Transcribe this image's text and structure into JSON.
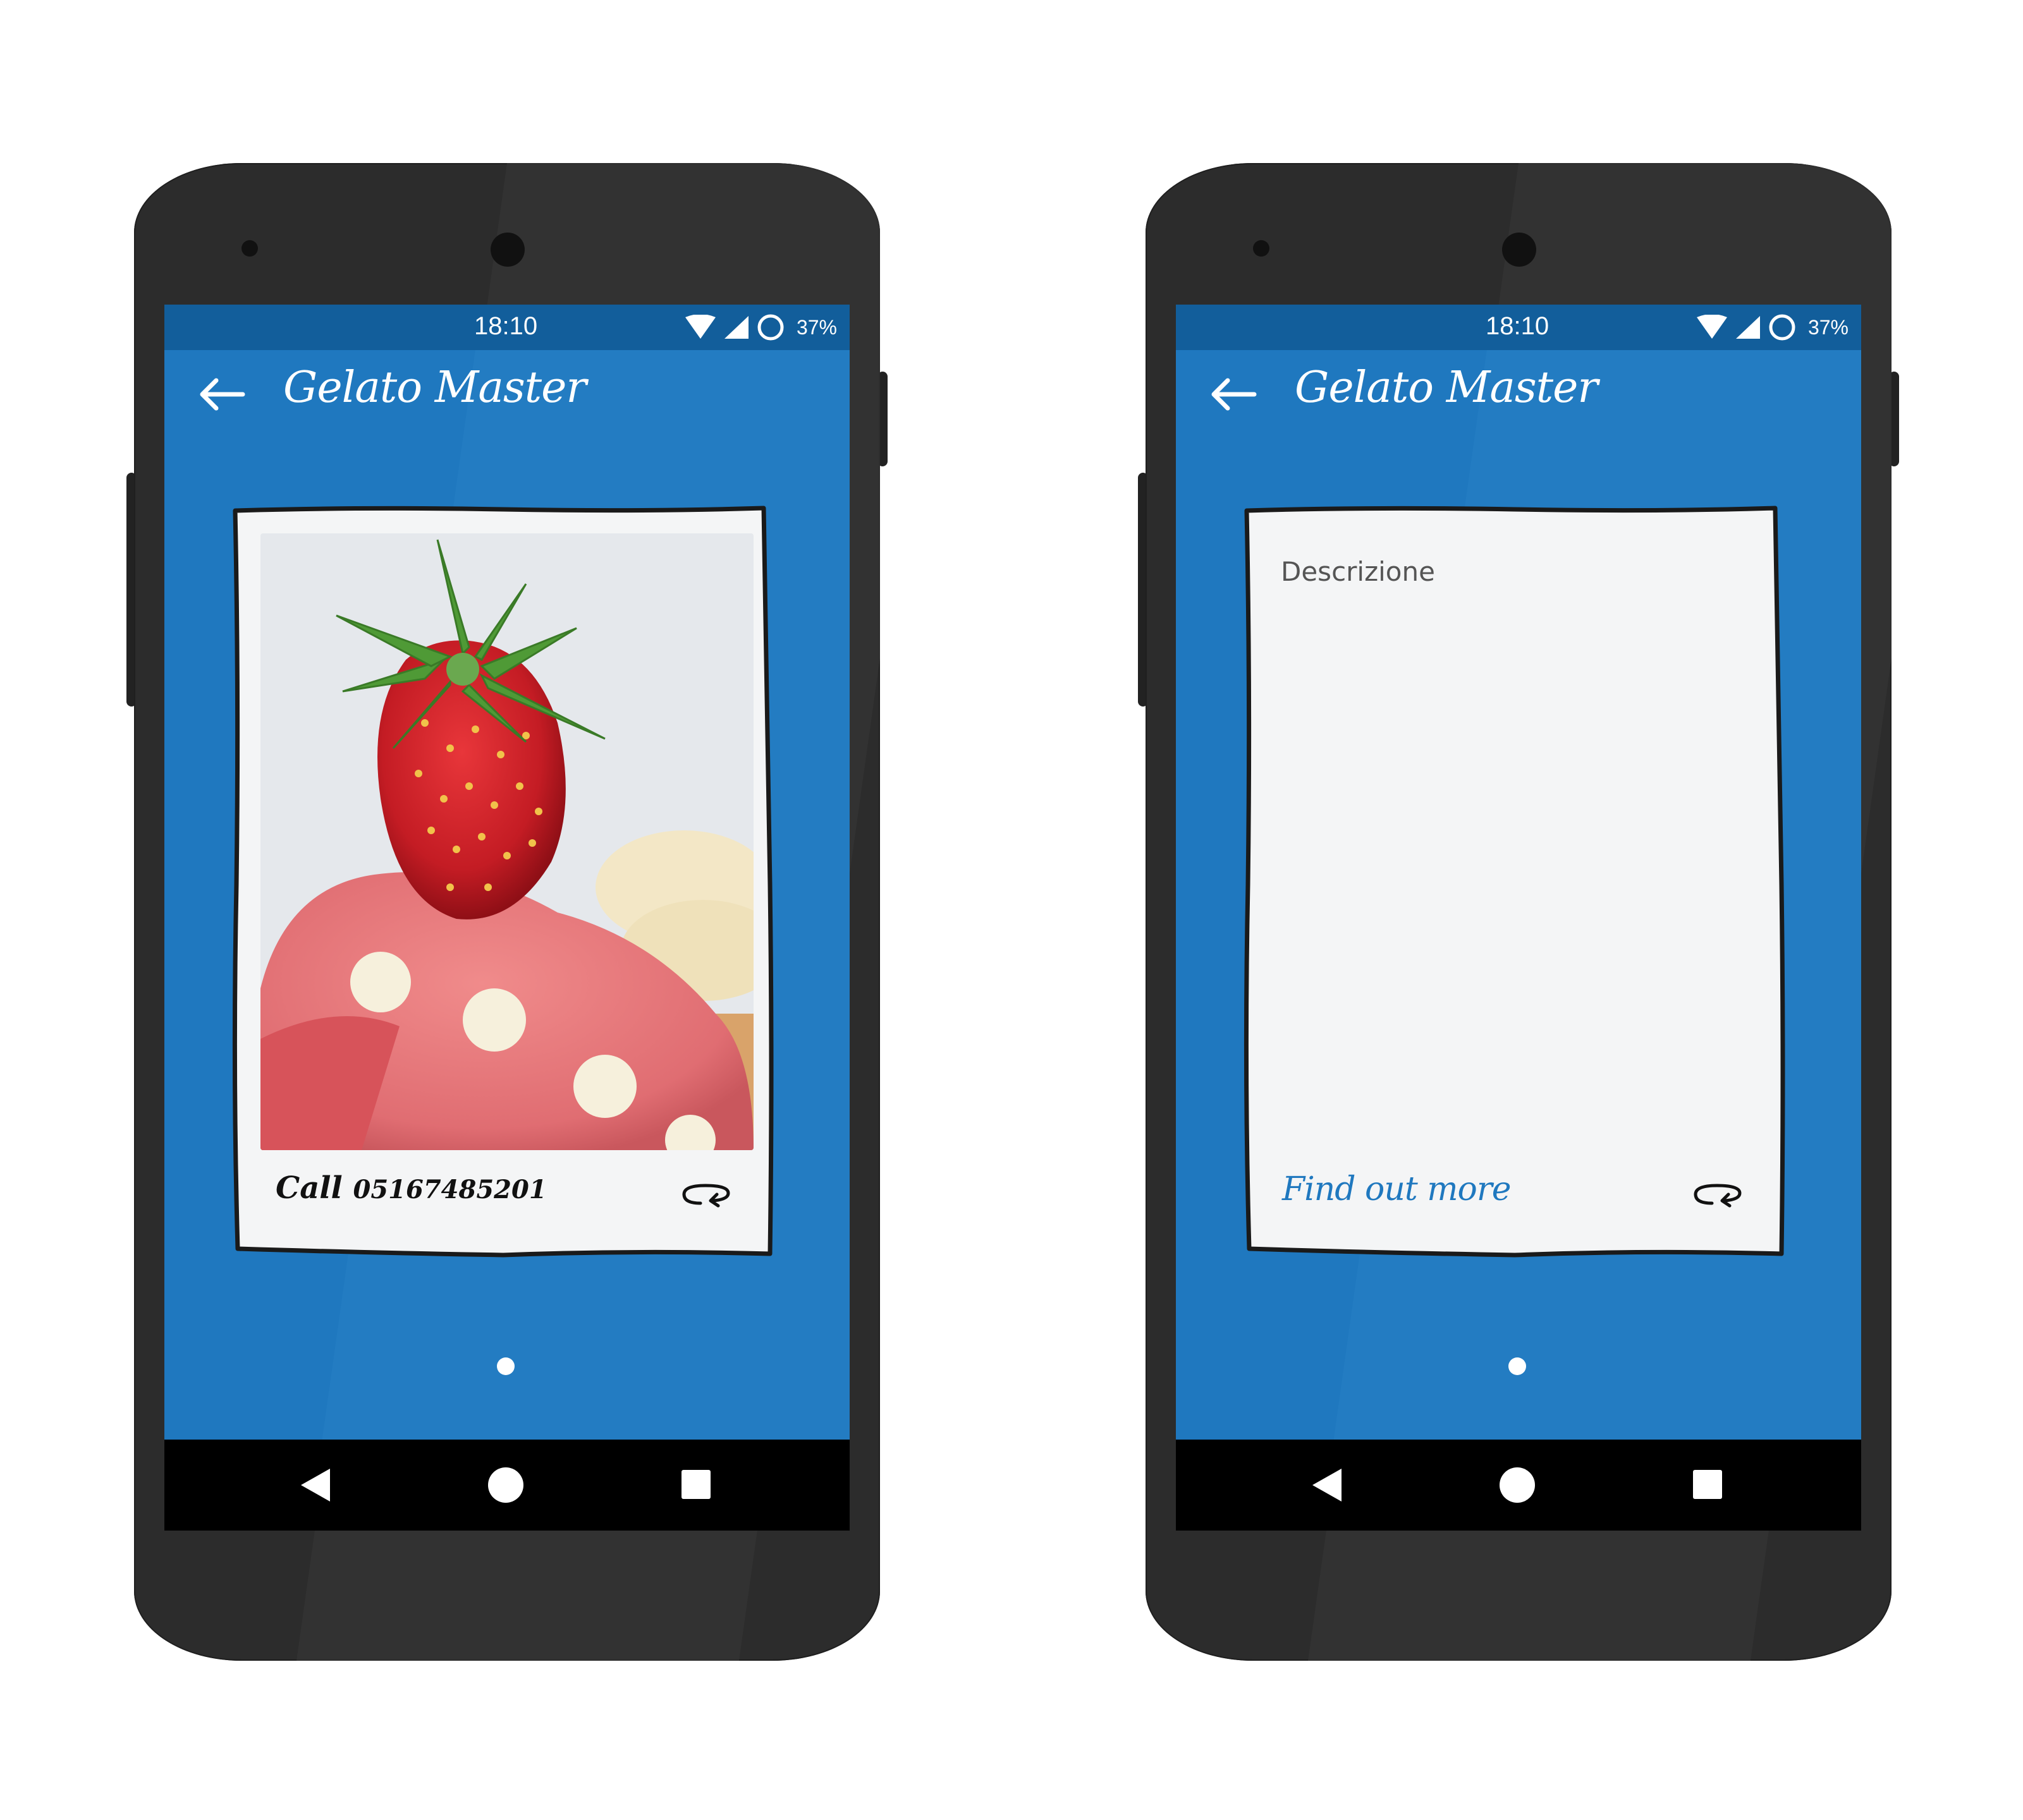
{
  "colors": {
    "screen_bg": "#1f78bf",
    "status_bar_bg": "#125e9b",
    "card_bg": "#f4f5f6",
    "accent_link": "#1f78bf",
    "phone_body": "#2c2c2c",
    "nav_bar_bg": "#000000"
  },
  "phones": [
    {
      "status": {
        "time": "18:10",
        "battery": "37%",
        "icons": [
          "wifi-icon",
          "cell-signal-icon",
          "battery-ring-icon"
        ]
      },
      "app_bar": {
        "back_icon": "arrow-left-icon",
        "title": "Gelato Master"
      },
      "card": {
        "side": "front",
        "image": "strawberry-gelato-photo",
        "call_label": "Call",
        "phone_number": "05167485201",
        "flip_icon": "flip-arrows-icon"
      },
      "page_indicator": "dot",
      "nav": [
        "back-triangle-icon",
        "home-circle-icon",
        "recents-square-icon"
      ]
    },
    {
      "status": {
        "time": "18:10",
        "battery": "37%",
        "icons": [
          "wifi-icon",
          "cell-signal-icon",
          "battery-ring-icon"
        ]
      },
      "app_bar": {
        "back_icon": "arrow-left-icon",
        "title": "Gelato Master"
      },
      "card": {
        "side": "back",
        "description": "Descrizione",
        "link_label": "Find out more",
        "flip_icon": "flip-arrows-icon"
      },
      "page_indicator": "dot",
      "nav": [
        "back-triangle-icon",
        "home-circle-icon",
        "recents-square-icon"
      ]
    }
  ]
}
